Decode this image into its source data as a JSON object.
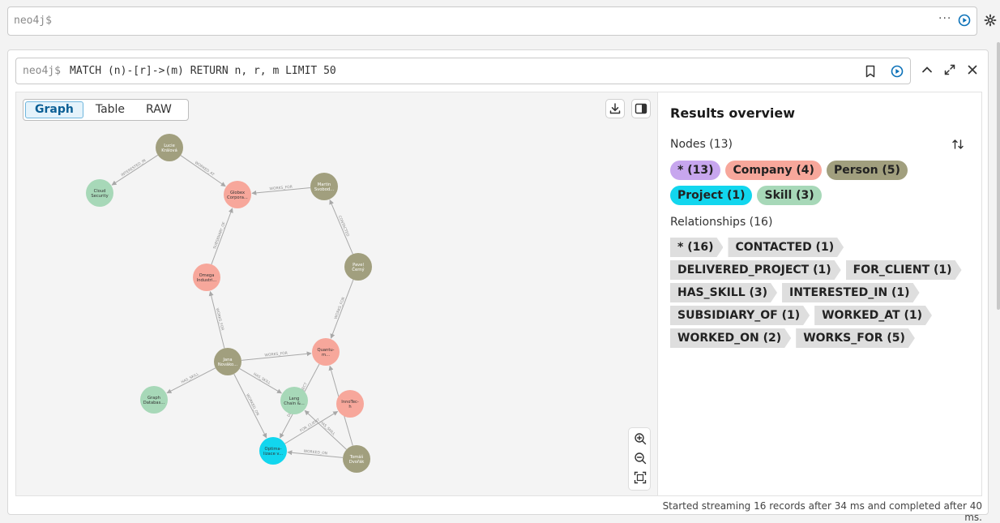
{
  "editor": {
    "prompt": "neo4j$",
    "dots": "···"
  },
  "frame": {
    "prompt": "neo4j$",
    "query": "MATCH (n)-[r]->(m) RETURN n, r, m LIMIT 50"
  },
  "view_tabs": [
    {
      "label": "Graph",
      "active": true
    },
    {
      "label": "Table",
      "active": false
    },
    {
      "label": "RAW",
      "active": false
    }
  ],
  "graph": {
    "nodes": [
      {
        "id": "lucie",
        "label": "Lucie\nKrálová",
        "type": "Person"
      },
      {
        "id": "cloud",
        "label": "Cloud\nSecurity",
        "type": "Skill"
      },
      {
        "id": "globex",
        "label": "Globex\nCorpora...",
        "type": "Company"
      },
      {
        "id": "martin",
        "label": "Martin\nSvobod...",
        "type": "Person"
      },
      {
        "id": "pavel",
        "label": "Pavel\nČerný",
        "type": "Person"
      },
      {
        "id": "omega",
        "label": "Omega\nIndustri...",
        "type": "Company"
      },
      {
        "id": "jana",
        "label": "Jana\nNováko...",
        "type": "Person"
      },
      {
        "id": "quantum",
        "label": "Quantu-\nm...",
        "type": "Company"
      },
      {
        "id": "graphdb",
        "label": "Graph\nDatabas...",
        "type": "Skill"
      },
      {
        "id": "langchain",
        "label": "Lang\nChain &...",
        "type": "Skill"
      },
      {
        "id": "innotech",
        "label": "InnoTec-\nh",
        "type": "Company"
      },
      {
        "id": "optima",
        "label": "Optima-\nlizace v...",
        "type": "Project"
      },
      {
        "id": "tomas",
        "label": "Tomáš\nDvořák",
        "type": "Person"
      }
    ],
    "edges": [
      {
        "from": "lucie",
        "to": "cloud",
        "label": "INTERESTED_IN"
      },
      {
        "from": "lucie",
        "to": "globex",
        "label": "WORKED_AT"
      },
      {
        "from": "martin",
        "to": "globex",
        "label": "WORKS_FOR"
      },
      {
        "from": "pavel",
        "to": "martin",
        "label": "CONTACTED"
      },
      {
        "from": "omega",
        "to": "globex",
        "label": "SUBSIDIARY_OF"
      },
      {
        "from": "pavel",
        "to": "quantum",
        "label": "WORKS_FOR"
      },
      {
        "from": "jana",
        "to": "omega",
        "label": "WORKS_FOR"
      },
      {
        "from": "jana",
        "to": "quantum",
        "label": "WORKS_FOR"
      },
      {
        "from": "jana",
        "to": "graphdb",
        "label": "HAS_SKILL"
      },
      {
        "from": "jana",
        "to": "langchain",
        "label": "HAS_SKILL"
      },
      {
        "from": "jana",
        "to": "optima",
        "label": "WORKED_ON"
      },
      {
        "from": "tomas",
        "to": "optima",
        "label": "WORKED_ON"
      },
      {
        "from": "tomas",
        "to": "quantum",
        "label": "WORKS_FOR"
      },
      {
        "from": "tomas",
        "to": "langchain",
        "label": "HAS_SKILL"
      },
      {
        "from": "optima",
        "to": "innotech",
        "label": "FOR_CLIENT"
      },
      {
        "from": "quantum",
        "to": "optima",
        "label": "DELIVERED_PROJECT"
      }
    ]
  },
  "colors": {
    "Person": "#a19f7e",
    "Company": "#f7a79b",
    "Skill": "#a7d8b8",
    "Project": "#12d6ee",
    "All": "#c7a6ee",
    "accent": "#0b71b8"
  },
  "overview": {
    "title": "Results overview",
    "nodes_label": "Nodes (13)",
    "node_chips": [
      {
        "label": "* (13)",
        "type": "All"
      },
      {
        "label": "Company (4)",
        "type": "Company"
      },
      {
        "label": "Person (5)",
        "type": "Person"
      },
      {
        "label": "Project (1)",
        "type": "Project"
      },
      {
        "label": "Skill (3)",
        "type": "Skill"
      }
    ],
    "relationships_label": "Relationships (16)",
    "rel_chips": [
      "* (16)",
      "CONTACTED (1)",
      "DELIVERED_PROJECT (1)",
      "FOR_CLIENT (1)",
      "HAS_SKILL (3)",
      "INTERESTED_IN (1)",
      "SUBSIDIARY_OF (1)",
      "WORKED_AT (1)",
      "WORKED_ON (2)",
      "WORKS_FOR (5)"
    ]
  },
  "status": "Started streaming 16 records after 34 ms and completed after 40 ms."
}
